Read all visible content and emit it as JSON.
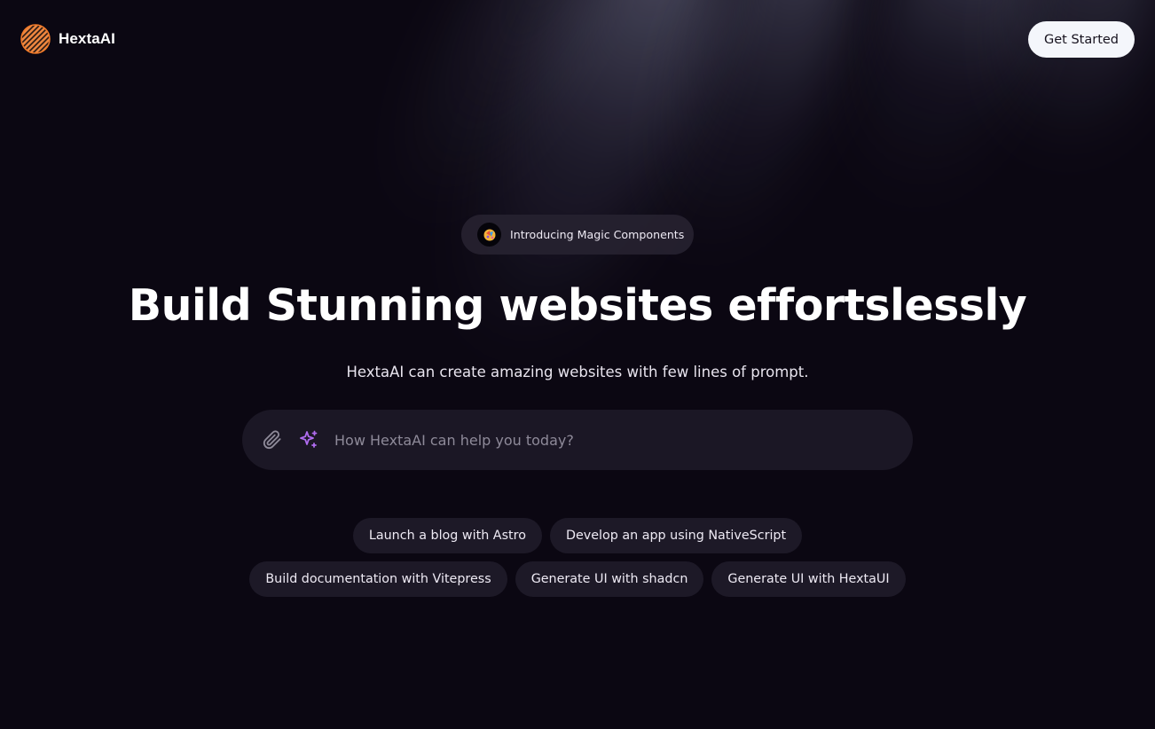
{
  "brand": {
    "name": "HextaAI",
    "logo_icon": "striped-circle-logo-icon",
    "accent_color": "#f07a2a"
  },
  "header": {
    "cta_label": "Get Started"
  },
  "announcement": {
    "icon": "party-emoji-icon",
    "text": "Introducing Magic Components"
  },
  "hero": {
    "title": "Build Stunning websites effortslessly",
    "subtitle": "HextaAI can create amazing websites with few lines of prompt."
  },
  "prompt": {
    "placeholder": "How HextaAI can help you today?",
    "value": "",
    "attach_icon": "paperclip-icon",
    "magic_icon": "sparkles-icon",
    "magic_color": "#b06cf0"
  },
  "suggestions": {
    "row1": [
      "Launch a blog with Astro",
      "Develop an app using NativeScript"
    ],
    "row2": [
      "Build documentation with Vitepress",
      "Generate UI with shadcn",
      "Generate UI with HextaUI"
    ]
  },
  "colors": {
    "background": "#0b0712",
    "surface": "#1b1725",
    "cta_background": "#f4f6fb"
  }
}
